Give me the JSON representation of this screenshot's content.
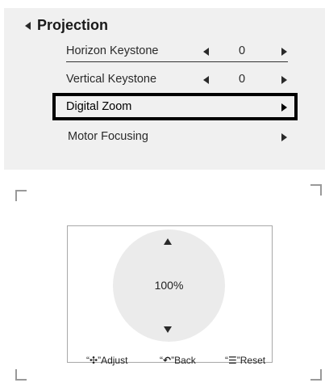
{
  "menu": {
    "title": "Projection",
    "items": [
      {
        "label": "Horizon Keystone",
        "value": "0"
      },
      {
        "label": "Vertical Keystone",
        "value": "0"
      },
      {
        "label": "Digital Zoom"
      },
      {
        "label": "Motor Focusing"
      }
    ]
  },
  "zoom": {
    "value": "100%"
  },
  "hints": {
    "adjust": {
      "open": "“",
      "icon": "✣",
      "close": "”",
      "label": "Adjust"
    },
    "back": {
      "open": "“",
      "icon": "↶",
      "close": "”",
      "label": "Back"
    },
    "reset": {
      "open": "“",
      "icon": "☰",
      "close": "”",
      "label": "Reset"
    }
  }
}
